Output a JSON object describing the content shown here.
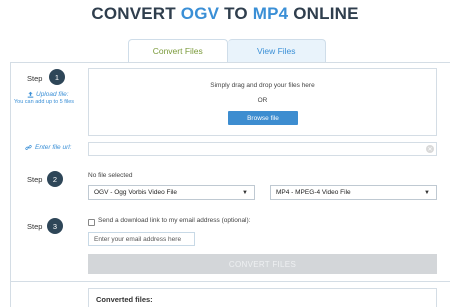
{
  "header": {
    "title_part1": "CONVERT ",
    "title_from": "OGV",
    "title_part2": " TO ",
    "title_to": "MP4",
    "title_part3": " ONLINE"
  },
  "tabs": [
    {
      "label": "Convert Files",
      "active": true
    },
    {
      "label": "View Files",
      "active": false
    }
  ],
  "step1": {
    "label": "Step",
    "number": "1",
    "upload_link": "Upload file:",
    "upload_sub": "You can add up to 5 files",
    "drop_text": "Simply drag and drop your files here",
    "or_text": "OR",
    "browse_label": "Browse file"
  },
  "url": {
    "label": "Enter file url:",
    "value": ""
  },
  "step2": {
    "label": "Step",
    "number": "2",
    "no_file": "No file selected",
    "from_format": "OGV - Ogg Vorbis Video File",
    "to_format": "MP4 - MPEG-4 Video File"
  },
  "step3": {
    "label": "Step",
    "number": "3",
    "email_checkbox_label": "Send a download link to my email address (optional):",
    "email_placeholder": "Enter your email address here",
    "convert_label": "CONVERT FILES"
  },
  "converted": {
    "title": "Converted files:"
  },
  "colors": {
    "accent": "#3a8fd6",
    "step_circle": "#2e4658",
    "tab_active_text": "#7a9a3a",
    "browse_button": "#3d8dd0",
    "convert_disabled": "#d3d6d9"
  }
}
